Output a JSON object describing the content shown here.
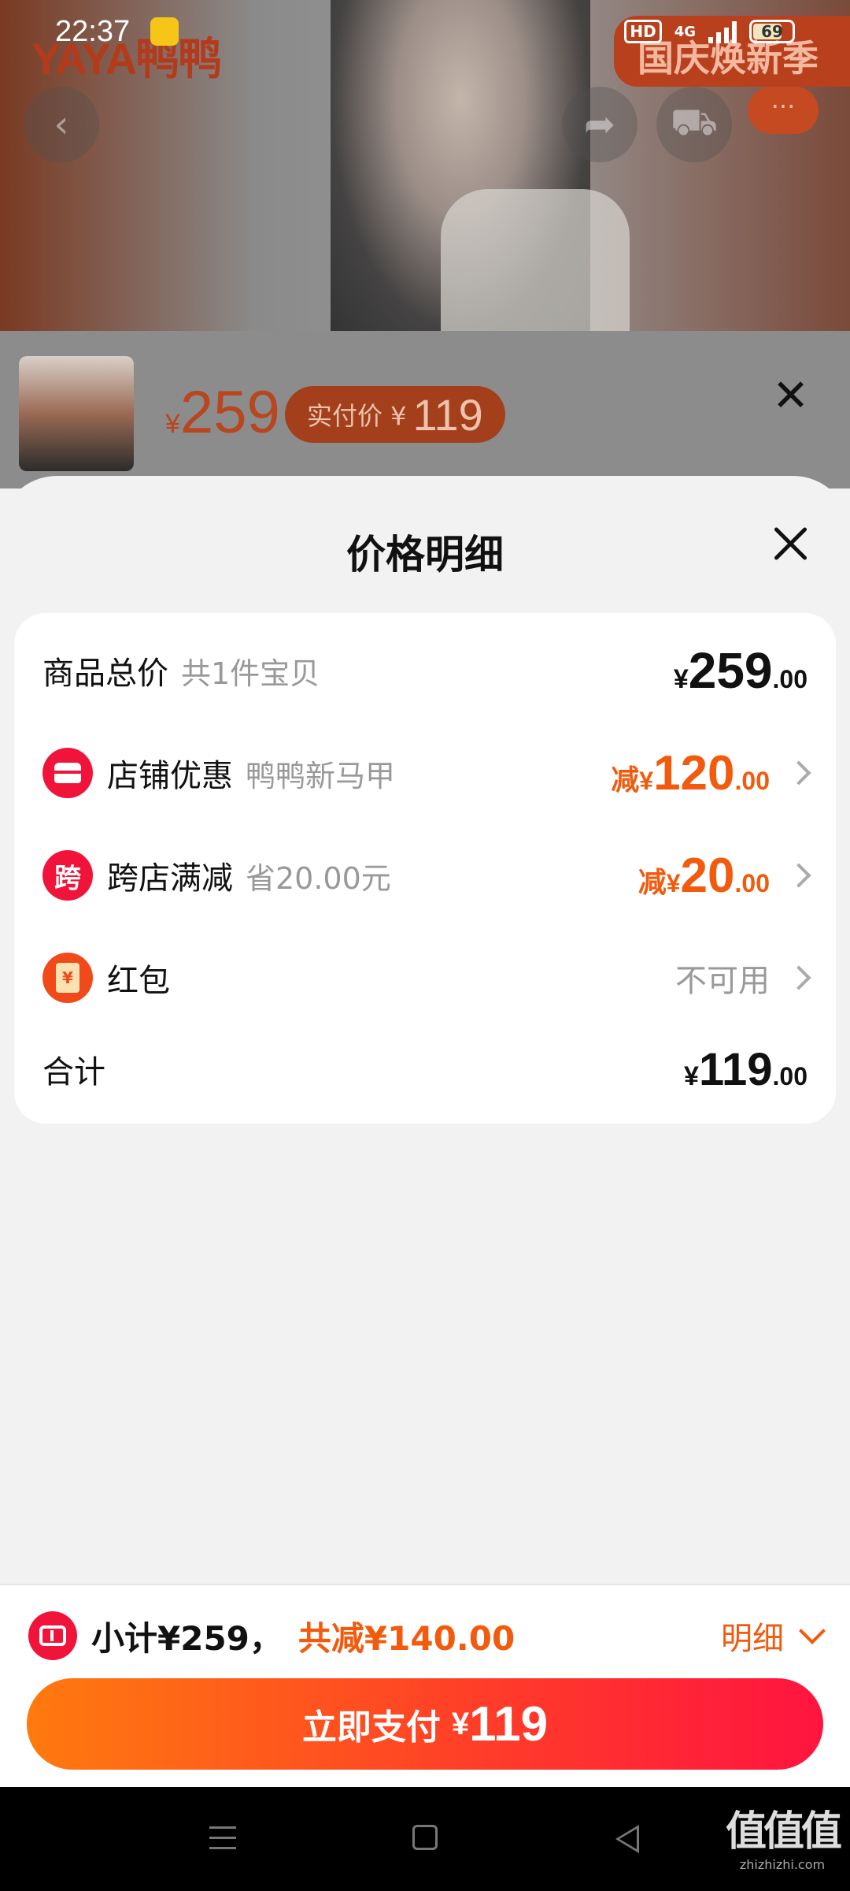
{
  "status_bar": {
    "time": "22:37",
    "network_badge": "HD",
    "network_type": "4G",
    "battery": "69"
  },
  "background_page": {
    "brand_logo_text": "YAYA鸭鸭",
    "promo_text": "国庆焕新季",
    "more_label": "···",
    "sku_price_yen": "¥",
    "sku_price": "259",
    "sku_paid_label": "实付价 ¥",
    "sku_paid_value": "119"
  },
  "sheet": {
    "title": "价格明细",
    "rows": [
      {
        "label": "商品总价",
        "sub": "共1件宝贝",
        "yen": "¥",
        "int": "259",
        "dec": ".00"
      },
      {
        "label": "店铺优惠",
        "sub": "鸭鸭新马甲",
        "prefix": "减",
        "yen": "¥",
        "int": "120",
        "dec": ".00"
      },
      {
        "label": "跨店满减",
        "sub": "省20.00元",
        "icon_text": "跨",
        "prefix": "减",
        "yen": "¥",
        "int": "20",
        "dec": ".00"
      },
      {
        "label": "红包",
        "value": "不可用",
        "icon_text": "¥"
      },
      {
        "label": "合计",
        "yen": "¥",
        "int": "119",
        "dec": ".00"
      }
    ]
  },
  "footer": {
    "subtotal": "小计¥259，",
    "saved": "共减¥140.00",
    "detail_label": "明细",
    "pay_label": "立即支付",
    "pay_yen": "¥",
    "pay_amount": "119"
  },
  "watermark": {
    "big": "值值值",
    "small": "zhizhizhi.com"
  },
  "colors": {
    "accent_orange": "#f25b0e",
    "accent_red": "#f0143a",
    "pay_gradient_start": "#ff7a0e",
    "pay_gradient_end": "#ff1440"
  }
}
